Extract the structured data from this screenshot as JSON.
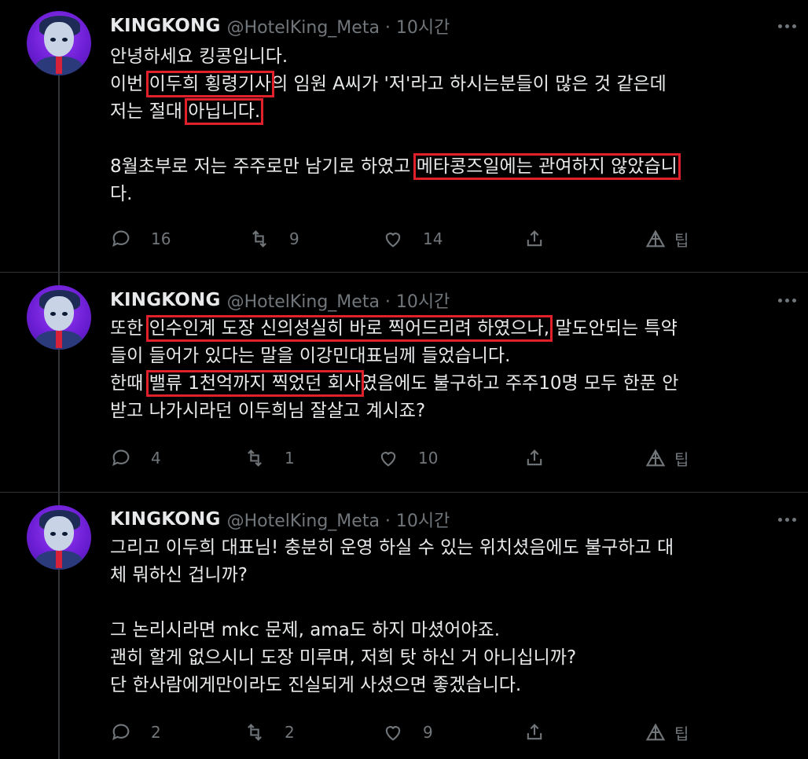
{
  "tweets": [
    {
      "user": {
        "name": "KINGKONG",
        "handle_time": "@HotelKing_Meta · 10시간"
      },
      "lines": [
        [
          {
            "t": "안녕하세요 킹콩입니다."
          }
        ],
        [
          {
            "t": "이번 "
          },
          {
            "t": "이두희 횡령기사",
            "hl": true
          },
          {
            "t": "의 임원 A씨가 '저'라고 하시는분들이 많은 것 같은데"
          }
        ],
        [
          {
            "t": "저는 절대 "
          },
          {
            "t": "아닙니다.",
            "hl": true
          }
        ],
        [
          {
            "t": ""
          }
        ],
        [
          {
            "t": "8월초부로 저는 주주로만 남기로 하였고 "
          },
          {
            "t": " 메타콩즈일에는 관여하지 않았습니",
            "hl": true
          }
        ],
        [
          {
            "t": "다."
          }
        ]
      ],
      "actions": {
        "reply": "16",
        "retweet": "9",
        "like": "14",
        "tip": "팁"
      }
    },
    {
      "user": {
        "name": "KINGKONG",
        "handle_time": "@HotelKing_Meta · 10시간"
      },
      "lines": [
        [
          {
            "t": "또한 "
          },
          {
            "t": "인수인계 도장 신의성실히 바로 찍어드리려 하였으나,",
            "hl": true
          },
          {
            "t": " 말도안되는 특약"
          }
        ],
        [
          {
            "t": "들이 들어가 있다는 말을 이강민대표님께 들었습니다."
          }
        ],
        [
          {
            "t": "한때 "
          },
          {
            "t": "밸류 1천억까지 찍었던 회사",
            "hl": true
          },
          {
            "t": "였음에도 불구하고 주주10명 모두 한푼 안"
          }
        ],
        [
          {
            "t": "받고 나가시라던 이두희님 잘살고 계시죠?"
          }
        ]
      ],
      "actions": {
        "reply": "4",
        "retweet": "1",
        "like": "10",
        "tip": "팁"
      }
    },
    {
      "user": {
        "name": "KINGKONG",
        "handle_time": "@HotelKing_Meta · 10시간"
      },
      "lines": [
        [
          {
            "t": "그리고 이두희 대표님! 충분히 운영 하실 수 있는 위치셨음에도 불구하고 대"
          }
        ],
        [
          {
            "t": "체 뭐하신 겁니까?"
          }
        ],
        [
          {
            "t": ""
          }
        ],
        [
          {
            "t": "그 논리시라면 mkc 문제, ama도 하지 마셨어야죠."
          }
        ],
        [
          {
            "t": "괜히 할게 없으시니 도장 미루며, 저희 탓 하신 거 아니십니까?"
          }
        ],
        [
          {
            "t": "단 한사람에게만이라도 진실되게 사셨으면 좋겠습니다."
          }
        ]
      ],
      "actions": {
        "reply": "2",
        "retweet": "2",
        "like": "9",
        "tip": "팁"
      }
    }
  ],
  "icons": {
    "reply": "reply-icon",
    "retweet": "retweet-icon",
    "like": "heart-icon",
    "share": "share-icon",
    "tip": "tip-icon",
    "more": "more-icon"
  },
  "colors": {
    "background": "#000000",
    "text": "#e7e9ea",
    "muted": "#71767b",
    "highlight_box": "#e0202a"
  }
}
